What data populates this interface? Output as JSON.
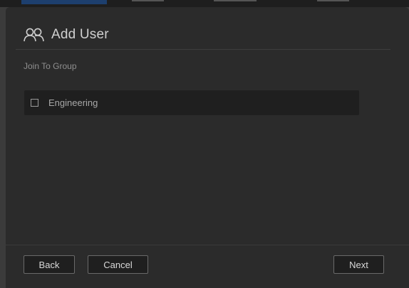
{
  "dialog": {
    "title": "Add User",
    "title_icon": "users-icon",
    "section_label": "Join To Group"
  },
  "groups": [
    {
      "label": "Engineering",
      "checked": false
    }
  ],
  "footer": {
    "back_label": "Back",
    "cancel_label": "Cancel",
    "next_label": "Next"
  },
  "colors": {
    "dialog_background": "#2b2b2b",
    "row_background": "#1f1f1f",
    "title_text": "#d0d0d0"
  }
}
